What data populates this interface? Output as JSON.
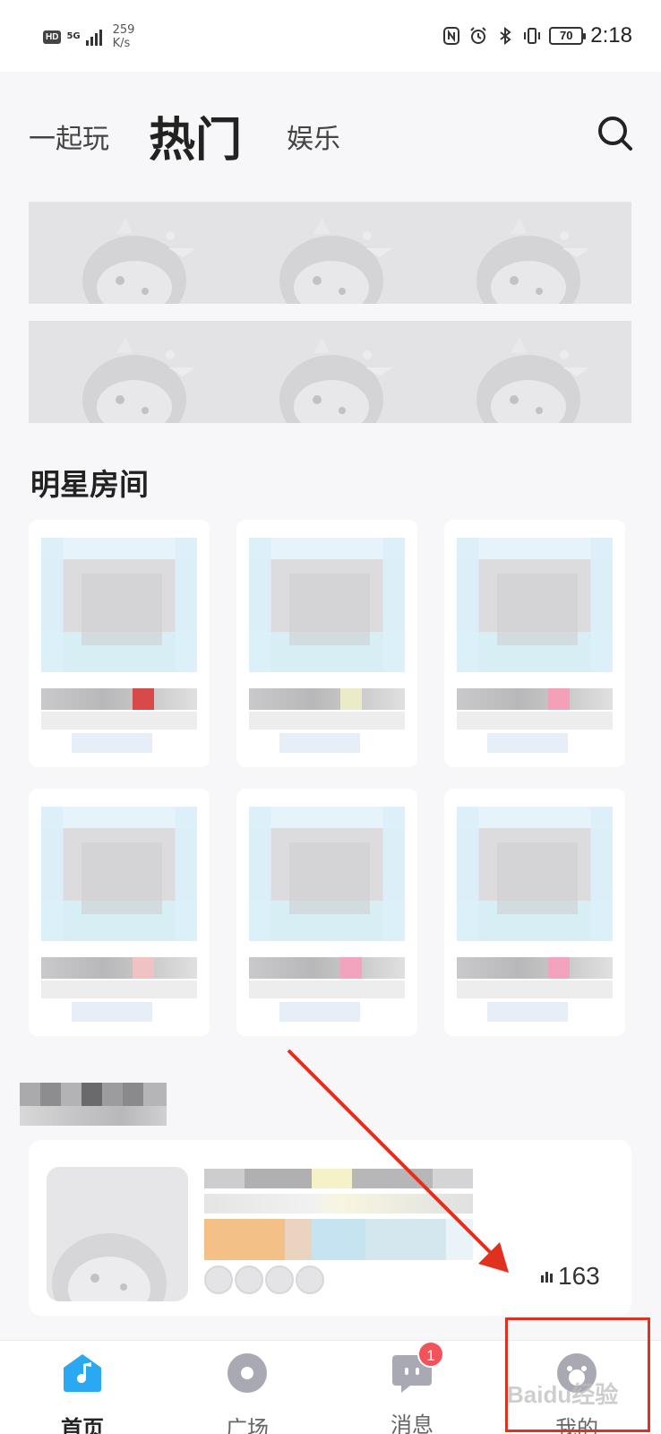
{
  "status_bar": {
    "hd": "HD",
    "network": "5G",
    "speed_value": "259",
    "speed_unit": "K/s",
    "battery": "70",
    "time": "2:18"
  },
  "top_nav": {
    "tabs": [
      "一起玩",
      "热门",
      "娱乐"
    ],
    "active_tab": "热门"
  },
  "sections": {
    "star_rooms_title": "明星房间"
  },
  "room_tag_colors": [
    "#d84a4a",
    "#ecebc9",
    "#f3a0b9",
    "#f1c2c3",
    "#f2a3bd",
    "#f2a3bd"
  ],
  "live_card": {
    "viewer_count": "163"
  },
  "bottom_tabs": {
    "home": "首页",
    "square": "广场",
    "messages": "消息",
    "messages_badge": "1",
    "mine": "我的",
    "active": "首页"
  },
  "colors": {
    "accent_blue": "#2aa8f2",
    "badge_red": "#f2525a",
    "annotation_red": "#e0301e"
  },
  "watermark": "Baidu经验"
}
